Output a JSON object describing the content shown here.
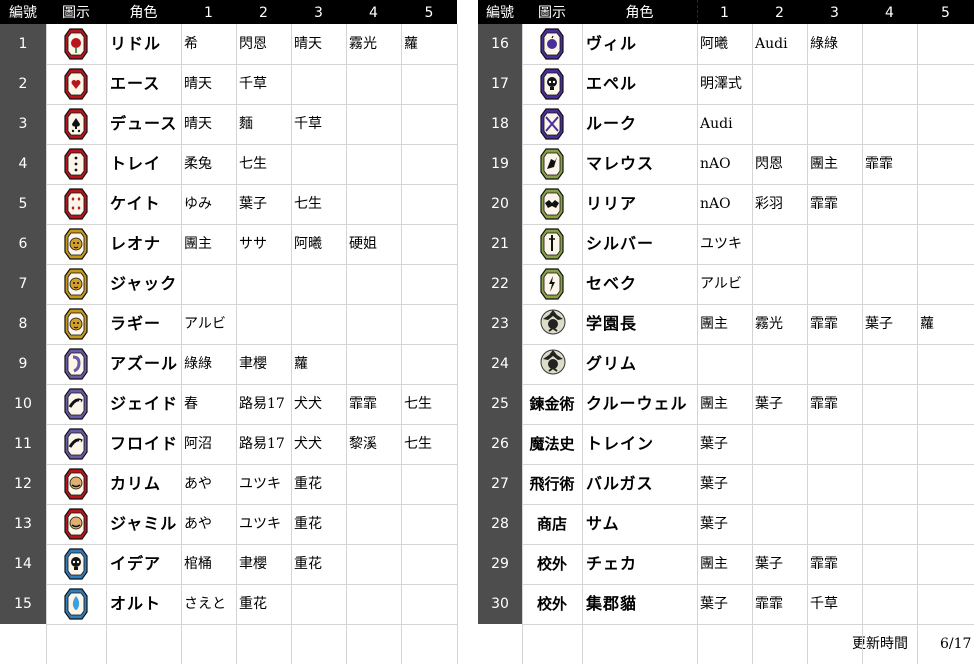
{
  "headers": {
    "left": [
      "編號",
      "圖示",
      "角色",
      "1",
      "2",
      "3",
      "4",
      "5"
    ],
    "right": [
      "編號",
      "圖示",
      "角色",
      "1",
      "2",
      "3",
      "4",
      "5"
    ]
  },
  "left_rows": [
    {
      "num": "1",
      "name": "リドル",
      "va": [
        "希",
        "閃恩",
        "晴天",
        "霧光",
        "蘿"
      ],
      "icon": "heart-rose-icon",
      "color": "#b8161c",
      "symbol": "rose"
    },
    {
      "num": "2",
      "name": "エース",
      "va": [
        "晴天",
        "千草",
        "",
        "",
        ""
      ],
      "icon": "heart-card-icon",
      "color": "#b8161c",
      "symbol": "heart"
    },
    {
      "num": "3",
      "name": "デュース",
      "va": [
        "晴天",
        "麵",
        "千草",
        "",
        ""
      ],
      "icon": "spade-card-icon",
      "color": "#b8161c",
      "symbol": "spade"
    },
    {
      "num": "4",
      "name": "トレイ",
      "va": [
        "柔兔",
        "七生",
        "",
        "",
        ""
      ],
      "icon": "club-card-icon",
      "color": "#b8161c",
      "symbol": "club"
    },
    {
      "num": "5",
      "name": "ケイト",
      "va": [
        "ゆみ",
        "葉子",
        "七生",
        "",
        ""
      ],
      "icon": "diamond-card-icon",
      "color": "#b8161c",
      "symbol": "diamond"
    },
    {
      "num": "6",
      "name": "レオナ",
      "va": [
        "團主",
        "ササ",
        "阿曦",
        "硬姐",
        ""
      ],
      "icon": "lion-icon",
      "color": "#c79a1c",
      "symbol": "lion"
    },
    {
      "num": "7",
      "name": "ジャック",
      "va": [
        "",
        "",
        "",
        "",
        ""
      ],
      "icon": "wolf-icon",
      "color": "#c79a1c",
      "symbol": "wolf"
    },
    {
      "num": "8",
      "name": "ラギー",
      "va": [
        "アルビ",
        "",
        "",
        "",
        ""
      ],
      "icon": "hyena-icon",
      "color": "#c79a1c",
      "symbol": "hyena"
    },
    {
      "num": "9",
      "name": "アズール",
      "va": [
        "綠綠",
        "聿櫻",
        "蘿",
        "",
        ""
      ],
      "icon": "octopus-icon",
      "color": "#6a5aa8",
      "symbol": "octo"
    },
    {
      "num": "10",
      "name": "ジェイド",
      "va": [
        "春",
        "路易17",
        "犬犬",
        "霏霏",
        "七生"
      ],
      "icon": "eel-icon",
      "color": "#6a5aa8",
      "symbol": "eel"
    },
    {
      "num": "11",
      "name": "フロイド",
      "va": [
        "阿沼",
        "路易17",
        "犬犬",
        "黎溪",
        "七生"
      ],
      "icon": "eel-icon",
      "color": "#6a5aa8",
      "symbol": "eel"
    },
    {
      "num": "12",
      "name": "カリム",
      "va": [
        "あや",
        "ユツキ",
        "重花",
        "",
        ""
      ],
      "icon": "mustache-icon",
      "color": "#b8161c",
      "symbol": "face"
    },
    {
      "num": "13",
      "name": "ジャミル",
      "va": [
        "あや",
        "ユツキ",
        "重花",
        "",
        ""
      ],
      "icon": "snake-face-icon",
      "color": "#b8161c",
      "symbol": "face"
    },
    {
      "num": "14",
      "name": "イデア",
      "va": [
        "棺桶",
        "聿櫻",
        "重花",
        "",
        ""
      ],
      "icon": "skull-icon",
      "color": "#2f7fc0",
      "symbol": "skull"
    },
    {
      "num": "15",
      "name": "オルト",
      "va": [
        "さえと",
        "重花",
        "",
        "",
        ""
      ],
      "icon": "flame-icon",
      "color": "#2f7fc0",
      "symbol": "flame"
    }
  ],
  "right_rows": [
    {
      "num": "16",
      "name": "ヴィル",
      "va": [
        "阿曦",
        "Audi",
        "綠綠",
        "",
        ""
      ],
      "icon": "apple-icon",
      "color": "#4a2f9a",
      "symbol": "apple",
      "cat": ""
    },
    {
      "num": "17",
      "name": "エペル",
      "va": [
        "明澤式",
        "",
        "",
        "",
        ""
      ],
      "icon": "skull-icon",
      "color": "#4a2f9a",
      "symbol": "skull",
      "cat": ""
    },
    {
      "num": "18",
      "name": "ルーク",
      "va": [
        "Audi",
        "",
        "",
        "",
        ""
      ],
      "icon": "arrow-icon",
      "color": "#4a2f9a",
      "symbol": "cross",
      "cat": ""
    },
    {
      "num": "19",
      "name": "マレウス",
      "va": [
        "nAO",
        "閃恩",
        "團主",
        "霏霏",
        ""
      ],
      "icon": "dragon-icon",
      "color": "#8aa24a",
      "symbol": "dragon",
      "cat": ""
    },
    {
      "num": "20",
      "name": "リリア",
      "va": [
        "nAO",
        "彩羽",
        "霏霏",
        "",
        ""
      ],
      "icon": "bat-icon",
      "color": "#8aa24a",
      "symbol": "bat",
      "cat": ""
    },
    {
      "num": "21",
      "name": "シルバー",
      "va": [
        "ユツキ",
        "",
        "",
        "",
        ""
      ],
      "icon": "sword-icon",
      "color": "#8aa24a",
      "symbol": "sword",
      "cat": ""
    },
    {
      "num": "22",
      "name": "セベク",
      "va": [
        "アルビ",
        "",
        "",
        "",
        ""
      ],
      "icon": "lightning-icon",
      "color": "#8aa24a",
      "symbol": "bolt",
      "cat": ""
    },
    {
      "num": "23",
      "name": "学園長",
      "va": [
        "團主",
        "霧光",
        "霏霏",
        "葉子",
        "蘿"
      ],
      "icon": "crow-emblem-icon",
      "color": "#555555",
      "symbol": "crow",
      "cat": ""
    },
    {
      "num": "24",
      "name": "グリム",
      "va": [
        "",
        "",
        "",
        "",
        ""
      ],
      "icon": "crow-emblem-icon",
      "color": "#555555",
      "symbol": "crow",
      "cat": ""
    },
    {
      "num": "25",
      "name": "クルーウェル",
      "va": [
        "團主",
        "葉子",
        "霏霏",
        "",
        ""
      ],
      "icon": "",
      "color": "",
      "symbol": "",
      "cat": "鍊金術"
    },
    {
      "num": "26",
      "name": "トレイン",
      "va": [
        "葉子",
        "",
        "",
        "",
        ""
      ],
      "icon": "",
      "color": "",
      "symbol": "",
      "cat": "魔法史"
    },
    {
      "num": "27",
      "name": "バルガス",
      "va": [
        "葉子",
        "",
        "",
        "",
        ""
      ],
      "icon": "",
      "color": "",
      "symbol": "",
      "cat": "飛行術"
    },
    {
      "num": "28",
      "name": "サム",
      "va": [
        "葉子",
        "",
        "",
        "",
        ""
      ],
      "icon": "",
      "color": "",
      "symbol": "",
      "cat": "商店"
    },
    {
      "num": "29",
      "name": "チェカ",
      "va": [
        "團主",
        "葉子",
        "霏霏",
        "",
        ""
      ],
      "icon": "",
      "color": "",
      "symbol": "",
      "cat": "校外"
    },
    {
      "num": "30",
      "name": "集郡貓",
      "va": [
        "葉子",
        "霏霏",
        "千草",
        "",
        ""
      ],
      "icon": "",
      "color": "",
      "symbol": "",
      "cat": "校外"
    }
  ],
  "footer": {
    "label": "更新時間",
    "date": "6/17"
  },
  "colors": {
    "header_bg": "#000000",
    "num_bg": "#4d4d4d",
    "gridline": "#d4d4d4"
  }
}
